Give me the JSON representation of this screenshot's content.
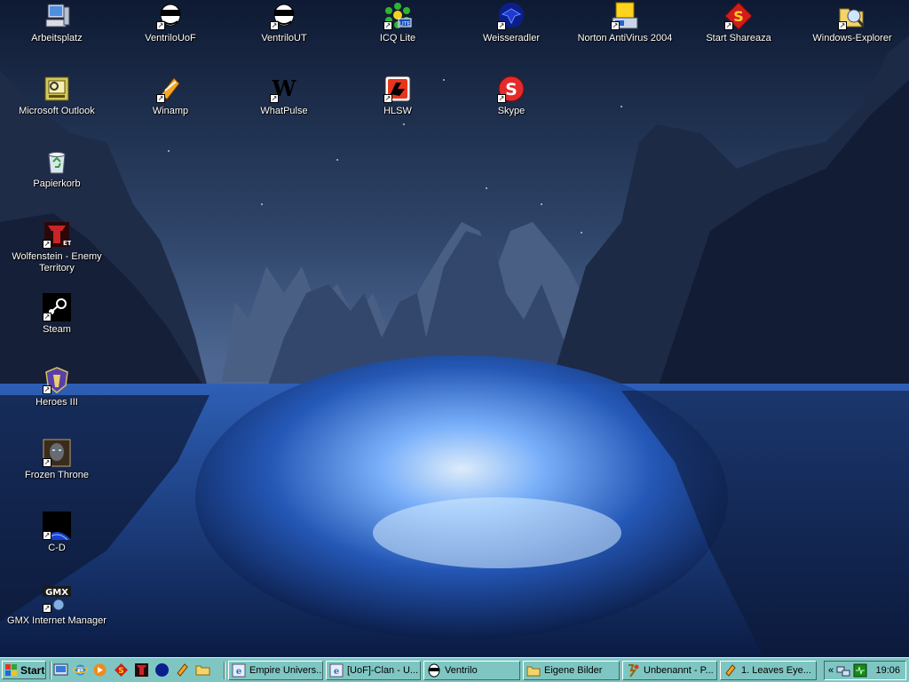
{
  "desktop": {
    "icons": [
      {
        "label": "Arbeitsplatz",
        "icon": "my-computer-icon",
        "shortcut": false
      },
      {
        "label": "VentriloUoF",
        "icon": "ventrilo-icon",
        "shortcut": true
      },
      {
        "label": "VentriloUT",
        "icon": "ventrilo-icon",
        "shortcut": true
      },
      {
        "label": "ICQ Lite",
        "icon": "icq-icon",
        "shortcut": true
      },
      {
        "label": "Weisseradler",
        "icon": "eagle-icon",
        "shortcut": true
      },
      {
        "label": "Norton AntiVirus 2004",
        "icon": "norton-icon",
        "shortcut": true
      },
      {
        "label": "Start Shareaza",
        "icon": "shareaza-icon",
        "shortcut": true
      },
      {
        "label": "Windows-Explorer",
        "icon": "explorer-icon",
        "shortcut": true
      },
      {
        "label": "Microsoft Outlook",
        "icon": "outlook-icon",
        "shortcut": false
      },
      {
        "label": "Winamp",
        "icon": "winamp-icon",
        "shortcut": true
      },
      {
        "label": "WhatPulse",
        "icon": "whatpulse-icon",
        "shortcut": true
      },
      {
        "label": "HLSW",
        "icon": "hlsw-icon",
        "shortcut": true
      },
      {
        "label": "Skype",
        "icon": "skype-icon",
        "shortcut": true
      },
      {
        "label": "Papierkorb",
        "icon": "recycle-bin-icon",
        "shortcut": false
      },
      {
        "label": "Wolfenstein - Enemy Territory",
        "icon": "wolfenstein-icon",
        "shortcut": true
      },
      {
        "label": "Steam",
        "icon": "steam-icon",
        "shortcut": true
      },
      {
        "label": "Heroes III",
        "icon": "heroes-icon",
        "shortcut": true
      },
      {
        "label": "Frozen Throne",
        "icon": "frozen-throne-icon",
        "shortcut": true
      },
      {
        "label": "C-D",
        "icon": "cd-icon",
        "shortcut": true
      },
      {
        "label": "GMX Internet Manager",
        "icon": "gmx-icon",
        "shortcut": true
      }
    ]
  },
  "taskbar": {
    "start_label": "Start",
    "quick_launch": [
      "show-desktop-icon",
      "internet-explorer-icon",
      "media-player-icon",
      "shareaza-icon",
      "wolfenstein-icon",
      "eagle-icon",
      "winamp-icon",
      "folder-icon"
    ],
    "tasks": [
      {
        "label": "Empire Univers...",
        "icon": "internet-explorer-icon"
      },
      {
        "label": "[UoF]-Clan - U...",
        "icon": "internet-explorer-icon"
      },
      {
        "label": "Ventrilo",
        "icon": "ventrilo-icon"
      },
      {
        "label": "Eigene Bilder",
        "icon": "folder-icon"
      },
      {
        "label": "Unbenannt - P...",
        "icon": "paint-icon"
      },
      {
        "label": "1. Leaves Eye...",
        "icon": "winamp-icon"
      }
    ],
    "tray": {
      "expand_label": "«",
      "icons": [
        "network-icon",
        "whatpulse-tray-icon"
      ],
      "clock": "19:06"
    }
  },
  "colors": {
    "taskbar": "#7fc6c2",
    "label_text": "#ffffff"
  }
}
